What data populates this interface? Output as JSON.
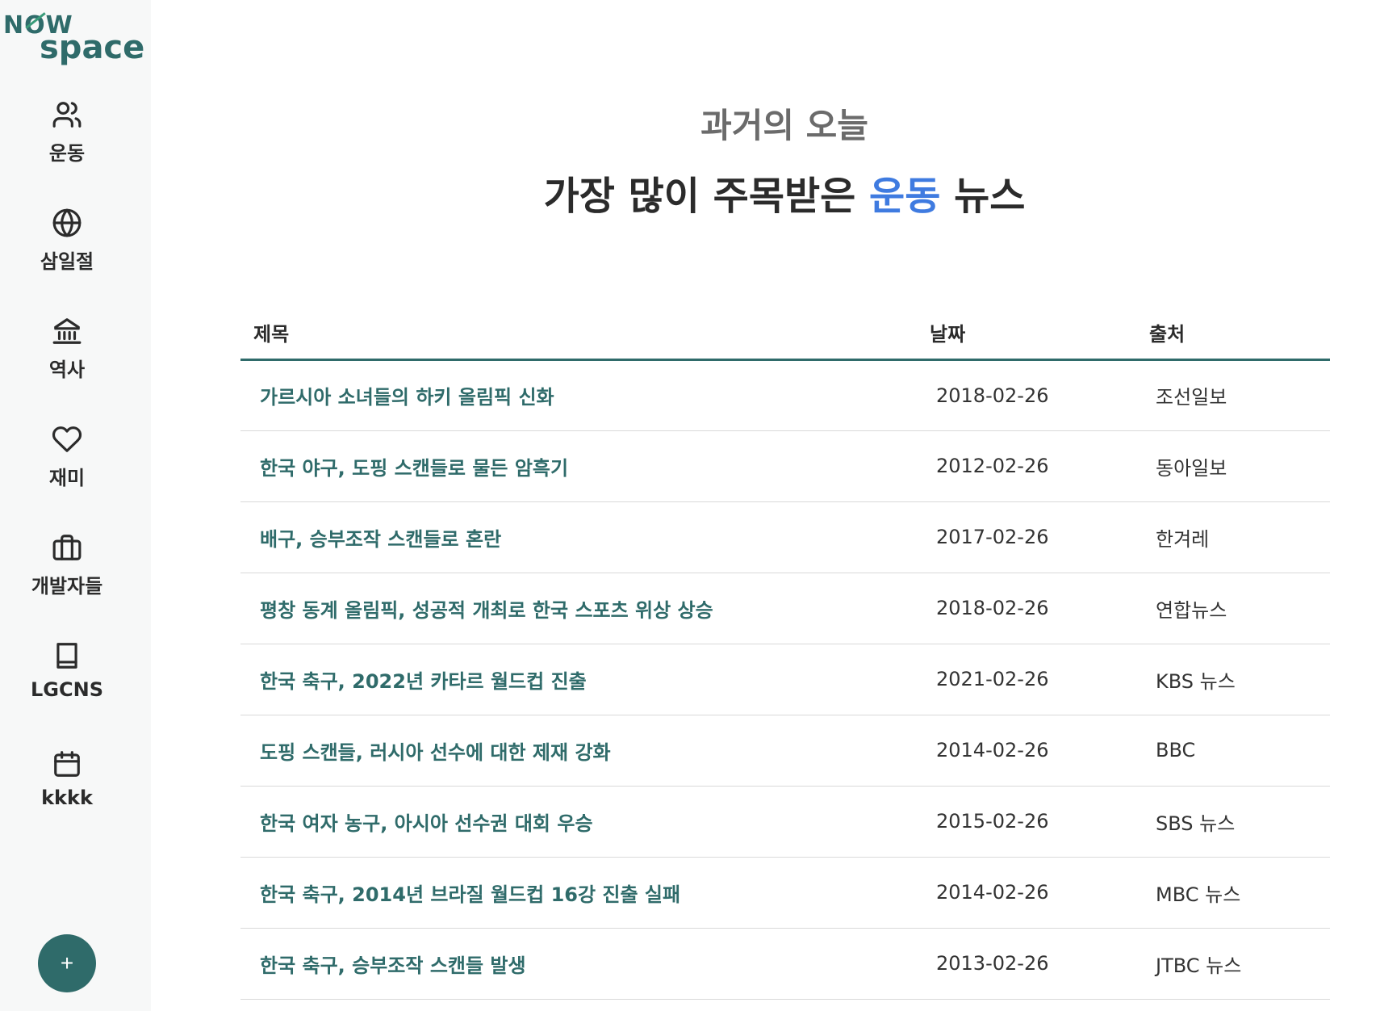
{
  "logo": {
    "line1": "NOW",
    "line2": "space"
  },
  "sidebar": {
    "items": [
      {
        "label": "운동",
        "icon": "users-icon"
      },
      {
        "label": "삼일절",
        "icon": "globe-icon"
      },
      {
        "label": "역사",
        "icon": "bank-icon"
      },
      {
        "label": "재미",
        "icon": "heart-icon"
      },
      {
        "label": "개발자들",
        "icon": "briefcase-icon"
      },
      {
        "label": "LGCNS",
        "icon": "book-icon"
      },
      {
        "label": "kkkk",
        "icon": "calendar-icon"
      }
    ],
    "fab_label": "+"
  },
  "header": {
    "subtitle": "과거의 오늘",
    "headline_before": "가장 많이 주목받은 ",
    "headline_accent": "운동",
    "headline_after": " 뉴스"
  },
  "table": {
    "columns": [
      "제목",
      "날짜",
      "출처"
    ],
    "rows": [
      {
        "title": "가르시아 소녀들의 하키 올림픽 신화",
        "date": "2018-02-26",
        "source": "조선일보"
      },
      {
        "title": "한국 야구, 도핑 스캔들로 물든 암흑기",
        "date": "2012-02-26",
        "source": "동아일보"
      },
      {
        "title": "배구, 승부조작 스캔들로 혼란",
        "date": "2017-02-26",
        "source": "한겨레"
      },
      {
        "title": "평창 동계 올림픽, 성공적 개최로 한국 스포츠 위상 상승",
        "date": "2018-02-26",
        "source": "연합뉴스"
      },
      {
        "title": "한국 축구, 2022년 카타르 월드컵 진출",
        "date": "2021-02-26",
        "source": "KBS 뉴스"
      },
      {
        "title": "도핑 스캔들, 러시아 선수에 대한 제재 강화",
        "date": "2014-02-26",
        "source": "BBC"
      },
      {
        "title": "한국 여자 농구, 아시아 선수권 대회 우승",
        "date": "2015-02-26",
        "source": "SBS 뉴스"
      },
      {
        "title": "한국 축구, 2014년 브라질 월드컵 16강 진출 실패",
        "date": "2014-02-26",
        "source": "MBC 뉴스"
      },
      {
        "title": "한국 축구, 승부조작 스캔들 발생",
        "date": "2013-02-26",
        "source": "JTBC 뉴스"
      }
    ]
  },
  "colors": {
    "brand": "#2f6b6a",
    "accent": "#3f7be0"
  }
}
